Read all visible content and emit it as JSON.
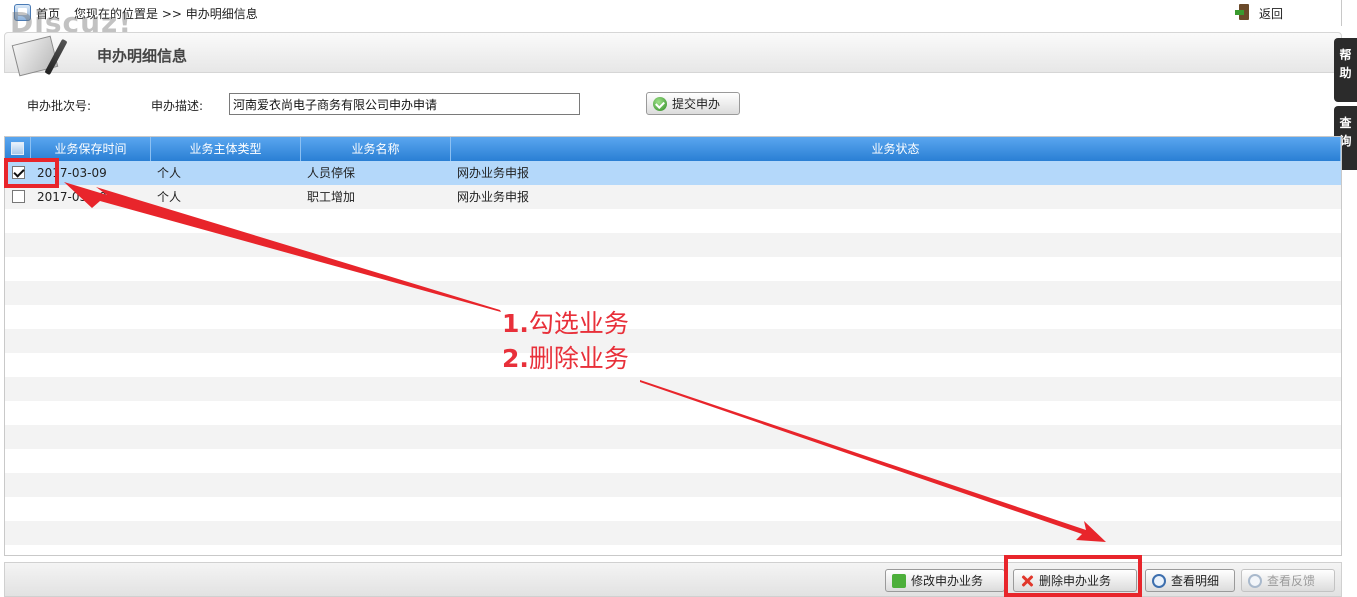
{
  "topbar": {
    "home_label": "首页",
    "breadcrumb": "您现在的位置是 >> 申办明细信息",
    "back_label": "返回",
    "watermark": "Discuz!"
  },
  "header": {
    "title": "申办明细信息"
  },
  "side_tabs": {
    "help": "帮助",
    "query": "查询"
  },
  "form": {
    "batch_label": "申办批次号:",
    "desc_label": "申办描述:",
    "desc_value": "河南爱衣尚电子商务有限公司申办申请",
    "submit_label": "提交申办"
  },
  "grid": {
    "columns": [
      "业务保存时间",
      "业务主体类型",
      "业务名称",
      "业务状态"
    ],
    "rows": [
      {
        "checked": true,
        "time": "2017-03-09",
        "type": "个人",
        "name": "人员停保",
        "status": "网办业务申报"
      },
      {
        "checked": false,
        "time": "2017-03-09",
        "type": "个人",
        "name": "职工增加",
        "status": "网办业务申报"
      }
    ]
  },
  "toolbar": {
    "edit_label": "修改申办业务",
    "delete_label": "删除申办业务",
    "detail_label": "查看明细",
    "feedback_label": "查看反馈"
  },
  "annotation": {
    "step1_num": "1.",
    "step1_text": "勾选业务",
    "step2_num": "2.",
    "step2_text": "删除业务",
    "color": "#e8303a"
  },
  "icons": {
    "home": "home-icon",
    "back": "exit-door-icon",
    "header": "document-pen-icon",
    "submit": "green-check-icon",
    "edit": "puzzle-piece-icon",
    "delete": "red-x-icon",
    "detail": "magnifier-icon",
    "feedback": "magnifier-icon"
  }
}
